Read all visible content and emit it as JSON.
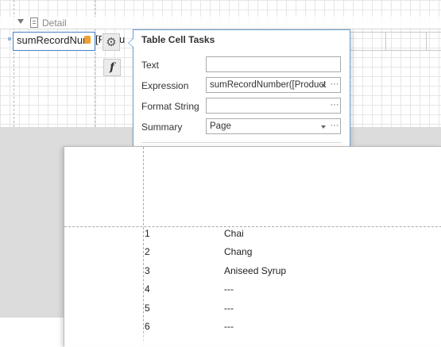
{
  "designer": {
    "band_label": "Detail",
    "cell_text": "sumRecordNur",
    "next_cell_text": "[P",
    "next_cell_text2": "u"
  },
  "tasks": {
    "title": "Table Cell Tasks",
    "text_label": "Text",
    "text_value": "",
    "expression_label": "Expression",
    "expression_value": "sumRecordNumber([Product",
    "format_label": "Format String",
    "format_value": "",
    "summary_label": "Summary",
    "summary_value": "Page"
  },
  "preview": {
    "rows": [
      {
        "num": "1",
        "name": "Chai"
      },
      {
        "num": "2",
        "name": "Chang"
      },
      {
        "num": "3",
        "name": "Aniseed Syrup"
      },
      {
        "num": "4",
        "name": "---"
      },
      {
        "num": "5",
        "name": "---"
      },
      {
        "num": "6",
        "name": "---"
      }
    ]
  },
  "icons": {
    "gear": "gear-icon",
    "function": "function-icon",
    "band": "band-icon",
    "ellipsis": "ellipsis-icon",
    "dropdown": "dropdown-icon"
  },
  "colors": {
    "accent_border": "#4a82c7",
    "panel_border": "#6a9fd6",
    "gray_area": "#dcdcdc"
  }
}
